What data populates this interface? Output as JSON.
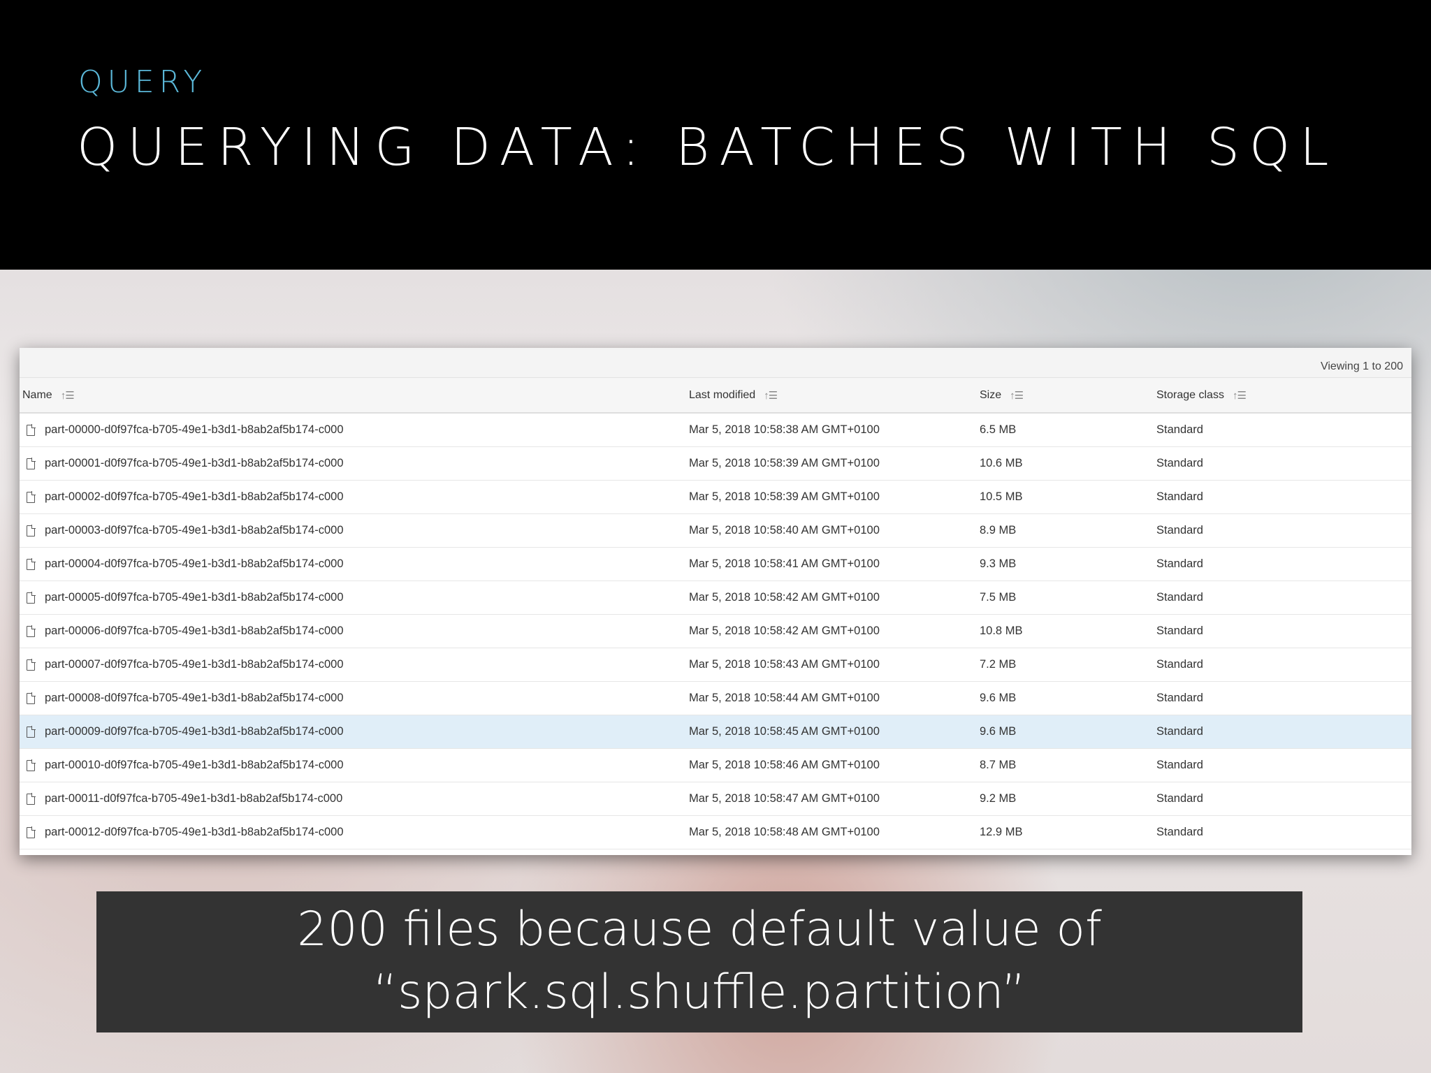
{
  "slide": {
    "kicker": "QUERY",
    "title": "QUERYING DATA: BATCHES WITH SQL",
    "caption_line1": "200 files because default value of",
    "caption_line2": "“spark.sql.shuffle.partition”"
  },
  "table": {
    "viewing": "Viewing 1 to 200",
    "columns": [
      "Name",
      "Last modified",
      "Size",
      "Storage class"
    ],
    "rows": [
      {
        "name": "part-00000-d0f97fca-b705-49e1-b3d1-b8ab2af5b174-c000",
        "modified": "Mar 5, 2018 10:58:38 AM GMT+0100",
        "size": "6.5 MB",
        "class": "Standard"
      },
      {
        "name": "part-00001-d0f97fca-b705-49e1-b3d1-b8ab2af5b174-c000",
        "modified": "Mar 5, 2018 10:58:39 AM GMT+0100",
        "size": "10.6 MB",
        "class": "Standard"
      },
      {
        "name": "part-00002-d0f97fca-b705-49e1-b3d1-b8ab2af5b174-c000",
        "modified": "Mar 5, 2018 10:58:39 AM GMT+0100",
        "size": "10.5 MB",
        "class": "Standard"
      },
      {
        "name": "part-00003-d0f97fca-b705-49e1-b3d1-b8ab2af5b174-c000",
        "modified": "Mar 5, 2018 10:58:40 AM GMT+0100",
        "size": "8.9 MB",
        "class": "Standard"
      },
      {
        "name": "part-00004-d0f97fca-b705-49e1-b3d1-b8ab2af5b174-c000",
        "modified": "Mar 5, 2018 10:58:41 AM GMT+0100",
        "size": "9.3 MB",
        "class": "Standard"
      },
      {
        "name": "part-00005-d0f97fca-b705-49e1-b3d1-b8ab2af5b174-c000",
        "modified": "Mar 5, 2018 10:58:42 AM GMT+0100",
        "size": "7.5 MB",
        "class": "Standard"
      },
      {
        "name": "part-00006-d0f97fca-b705-49e1-b3d1-b8ab2af5b174-c000",
        "modified": "Mar 5, 2018 10:58:42 AM GMT+0100",
        "size": "10.8 MB",
        "class": "Standard"
      },
      {
        "name": "part-00007-d0f97fca-b705-49e1-b3d1-b8ab2af5b174-c000",
        "modified": "Mar 5, 2018 10:58:43 AM GMT+0100",
        "size": "7.2 MB",
        "class": "Standard"
      },
      {
        "name": "part-00008-d0f97fca-b705-49e1-b3d1-b8ab2af5b174-c000",
        "modified": "Mar 5, 2018 10:58:44 AM GMT+0100",
        "size": "9.6 MB",
        "class": "Standard"
      },
      {
        "name": "part-00009-d0f97fca-b705-49e1-b3d1-b8ab2af5b174-c000",
        "modified": "Mar 5, 2018 10:58:45 AM GMT+0100",
        "size": "9.6 MB",
        "class": "Standard"
      },
      {
        "name": "part-00010-d0f97fca-b705-49e1-b3d1-b8ab2af5b174-c000",
        "modified": "Mar 5, 2018 10:58:46 AM GMT+0100",
        "size": "8.7 MB",
        "class": "Standard"
      },
      {
        "name": "part-00011-d0f97fca-b705-49e1-b3d1-b8ab2af5b174-c000",
        "modified": "Mar 5, 2018 10:58:47 AM GMT+0100",
        "size": "9.2 MB",
        "class": "Standard"
      },
      {
        "name": "part-00012-d0f97fca-b705-49e1-b3d1-b8ab2af5b174-c000",
        "modified": "Mar 5, 2018 10:58:48 AM GMT+0100",
        "size": "12.9 MB",
        "class": "Standard"
      }
    ],
    "selected_row_index": 9
  },
  "icons": {
    "file": "file-icon",
    "sort": "sort-icon"
  },
  "colors": {
    "header_bg": "#000000",
    "kicker": "#5bb8d9",
    "selected_row": "#e0eef8",
    "caption_bg": "#333333"
  }
}
